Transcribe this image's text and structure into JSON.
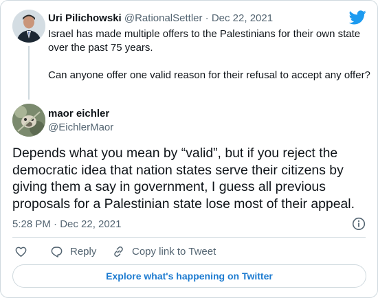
{
  "original_tweet": {
    "display_name": "Uri Pilichowski",
    "handle": "@RationalSettler",
    "separator": "·",
    "date": "Dec 22, 2021",
    "paragraph1": "Israel has made multiple offers to the Palestinians for their own state over the past 75 years.",
    "paragraph2": "Can anyone offer one valid reason for their refusal to accept any offer?"
  },
  "reply_tweet": {
    "display_name": "maor eichler",
    "handle": "@EichlerMaor",
    "text": "Depends what you mean by “valid”, but if you reject the democratic idea that nation states serve their citizens by giving them a say in government, I guess all previous proposals for a Palestinian state lose most of their appeal.",
    "timestamp": "5:28 PM · Dec 22, 2021"
  },
  "actions": {
    "reply_label": "Reply",
    "copy_label": "Copy link to Tweet"
  },
  "footer": {
    "explore_label": "Explore what's happening on Twitter"
  },
  "colors": {
    "accent": "#1d9bf0",
    "link": "#1d7bd0",
    "muted": "#536471",
    "border": "#cfd9de"
  },
  "icons": [
    "twitter-bird-icon",
    "info-icon",
    "heart-icon",
    "reply-bubble-icon",
    "copy-link-icon"
  ]
}
